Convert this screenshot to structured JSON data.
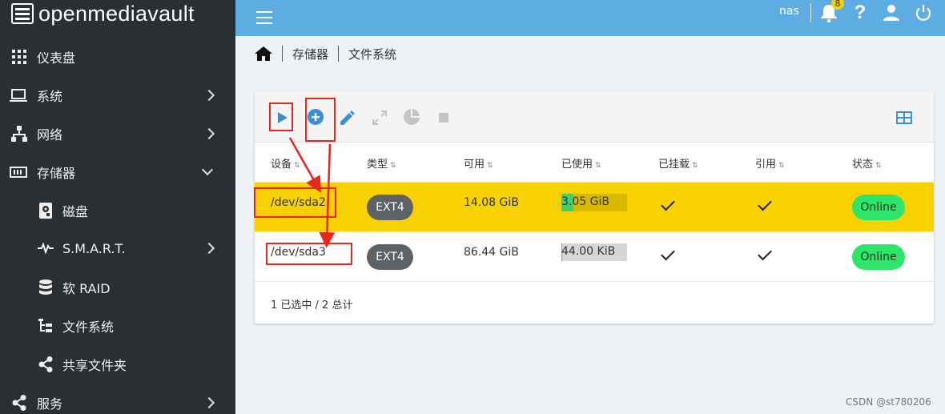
{
  "brand": {
    "name": "openmediavault"
  },
  "sidebar": {
    "items": [
      {
        "label": "仪表盘",
        "icon": "grid-icon"
      },
      {
        "label": "系统",
        "icon": "laptop-icon"
      },
      {
        "label": "网络",
        "icon": "network-icon"
      },
      {
        "label": "存储器",
        "icon": "storage-icon"
      },
      {
        "label": "磁盘",
        "icon": "disk-icon"
      },
      {
        "label": "S.M.A.R.T.",
        "icon": "pulse-icon"
      },
      {
        "label": "软 RAID",
        "icon": "database-icon"
      },
      {
        "label": "文件系统",
        "icon": "tree-icon"
      },
      {
        "label": "共享文件夹",
        "icon": "share-icon"
      },
      {
        "label": "服务",
        "icon": "share-icon"
      }
    ]
  },
  "topbar": {
    "user": "nas",
    "notification_count": "8"
  },
  "breadcrumb": {
    "level1": "存储器",
    "level2": "文件系统"
  },
  "table": {
    "headers": [
      "设备",
      "类型",
      "可用",
      "已使用",
      "已挂载",
      "引用",
      "状态"
    ],
    "rows": [
      {
        "device": "/dev/sda2",
        "type": "EXT4",
        "available": "14.08 GiB",
        "used": "3.05 GiB",
        "used_fraction": 0.18,
        "mounted": true,
        "referenced": true,
        "status": "Online",
        "selected": true
      },
      {
        "device": "/dev/sda3",
        "type": "EXT4",
        "available": "86.44 GiB",
        "used": "44.00 KiB",
        "used_fraction": 0.01,
        "mounted": true,
        "referenced": true,
        "status": "Online",
        "selected": false
      }
    ],
    "footer": "1 已选中 / 2 总计"
  },
  "colors": {
    "sidebar": "#2a2f33",
    "topbar": "#5dade2",
    "selected_row": "#f7d200",
    "online": "#2ee56b",
    "annotation": "#e8261c"
  },
  "watermark": "CSDN @st780206"
}
